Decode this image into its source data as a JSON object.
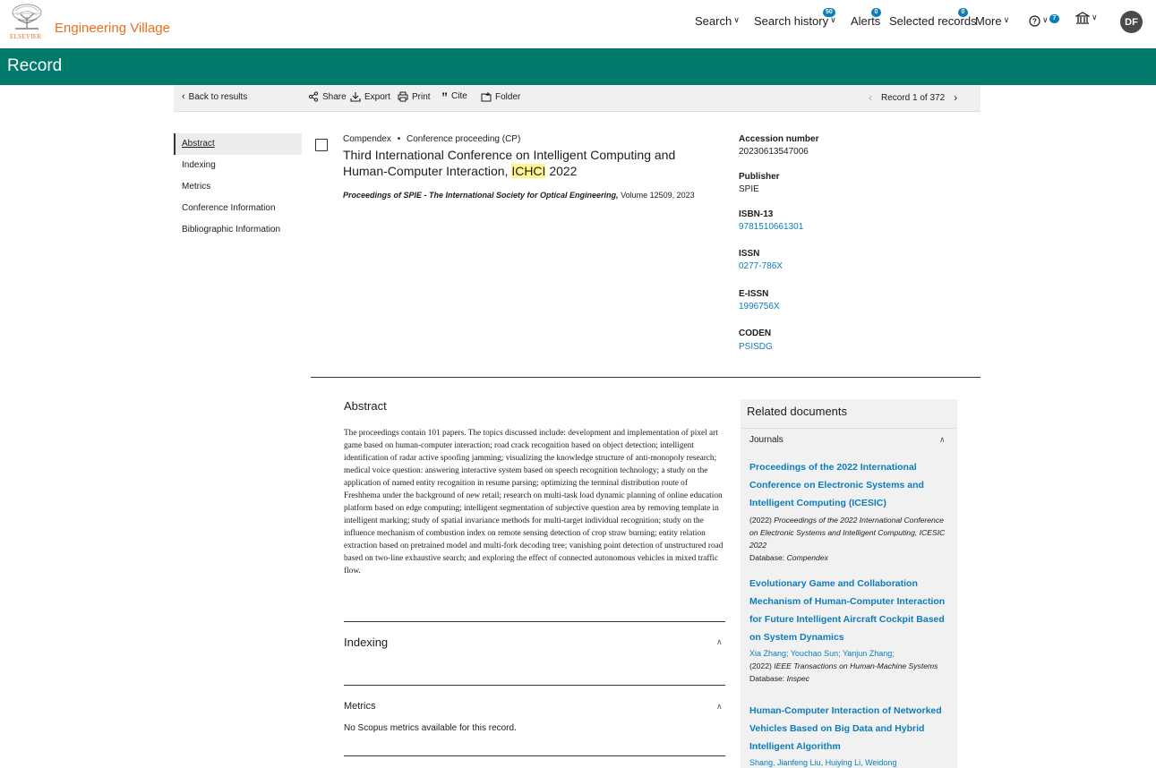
{
  "header": {
    "logo_text": "ELSEVIER",
    "brand": "Engineering Village",
    "nav": [
      {
        "label": "Search",
        "badge": ""
      },
      {
        "label": "Search history",
        "badge": "50"
      },
      {
        "label": "Alerts",
        "badge": "0"
      },
      {
        "label": "Selected records",
        "badge": "0"
      },
      {
        "label": "More",
        "badge": ""
      }
    ],
    "help_badge": "7",
    "avatar": "DF"
  },
  "page_title": "Record",
  "toolbar": {
    "back": "Back to results",
    "share": "Share",
    "export": "Export",
    "print": "Print",
    "cite": "Cite",
    "folder": "Folder",
    "record_position": "Record 1 of 372"
  },
  "sidenav": [
    "Abstract",
    "Indexing",
    "Metrics",
    "Conference Information",
    "Bibliographic Information"
  ],
  "record": {
    "database": "Compendex",
    "doc_type": "Conference proceeding (CP)",
    "title_part1": "Third International Conference on Intelligent Computing and Human-Computer Interaction,",
    "title_highlight": "ICHCI",
    "title_part2": "2022",
    "source_title": "Proceedings of SPIE - The International Society for Optical Engineering,",
    "source_rest": "Volume 12509, 2023"
  },
  "metadata": [
    {
      "label": "Accession number",
      "value": "20230613547006",
      "link": false
    },
    {
      "label": "Publisher",
      "value": "SPIE",
      "link": false
    },
    {
      "label": "ISBN-13",
      "value": "9781510661301",
      "link": true
    },
    {
      "label": "ISSN",
      "value": "0277-786X",
      "link": true
    },
    {
      "label": "E-ISSN",
      "value": "1996756X",
      "link": true
    },
    {
      "label": "CODEN",
      "value": "PSISDG",
      "link": true
    }
  ],
  "abstract": {
    "heading": "Abstract",
    "text": "The proceedings contain 101 papers. The topics discussed include: development and implementation of pixel art game based on human-computer interaction; road crack recognition based on object detection; intelligent identification of radar active spoofing jamming; visualizing the knowledge structure of anti-monopoly research; medical voice question: answering interactive system based on speech recognition technology; a study on the application of named entity recognition in resume parsing; optimizing the terminal distribution route of Freshhema under the background of new retail; research on multi-task load dynamic planning of online education platform based on edge computing; intelligent segmentation of subjective question area by removing template in intelligent marking; study of spatial invariance methods for multi-target individual recognition; study on the influence mechanism of combustion index on remote sensing detection of crop straw burning; entity relation extraction based on pretrained model and multi-fork decoding tree; vanishing point detection of unstructured road based on two-line exhaustive search; and exploring the effect of connected autonomous vehicles in mixed traffic flow."
  },
  "sections": {
    "indexing": "Indexing",
    "metrics": "Metrics",
    "metrics_text": "No Scopus metrics available for this record."
  },
  "related": {
    "heading": "Related documents",
    "group": "Journals",
    "items": [
      {
        "title": "Proceedings of the 2022 International Conference on Electronic Systems and Intelligent Computing (ICESIC)",
        "authors": [],
        "source_year": "(2022)",
        "source": "Proceedings of the 2022 International Conference on Electronic Systems and Intelligent Computing, ICESIC 2022",
        "database_label": "Database:",
        "database": "Compendex"
      },
      {
        "title": "Evolutionary Game and Collaboration Mechanism of Human-Computer Interaction for Future Intelligent Aircraft Cockpit Based on System Dynamics",
        "authors": [
          "Xia Zhang",
          "Youchao Sun",
          "Yanjun Zhang"
        ],
        "source_year": "(2022)",
        "source": "IEEE Transactions on Human-Machine Systems",
        "database_label": "Database:",
        "database": "Inspec"
      },
      {
        "title": "Human-Computer Interaction of Networked Vehicles Based on Big Data and Hybrid Intelligent Algorithm",
        "authors_text": "Shang, Jianfeng Liu, Huiying Li, Weidong"
      }
    ]
  }
}
